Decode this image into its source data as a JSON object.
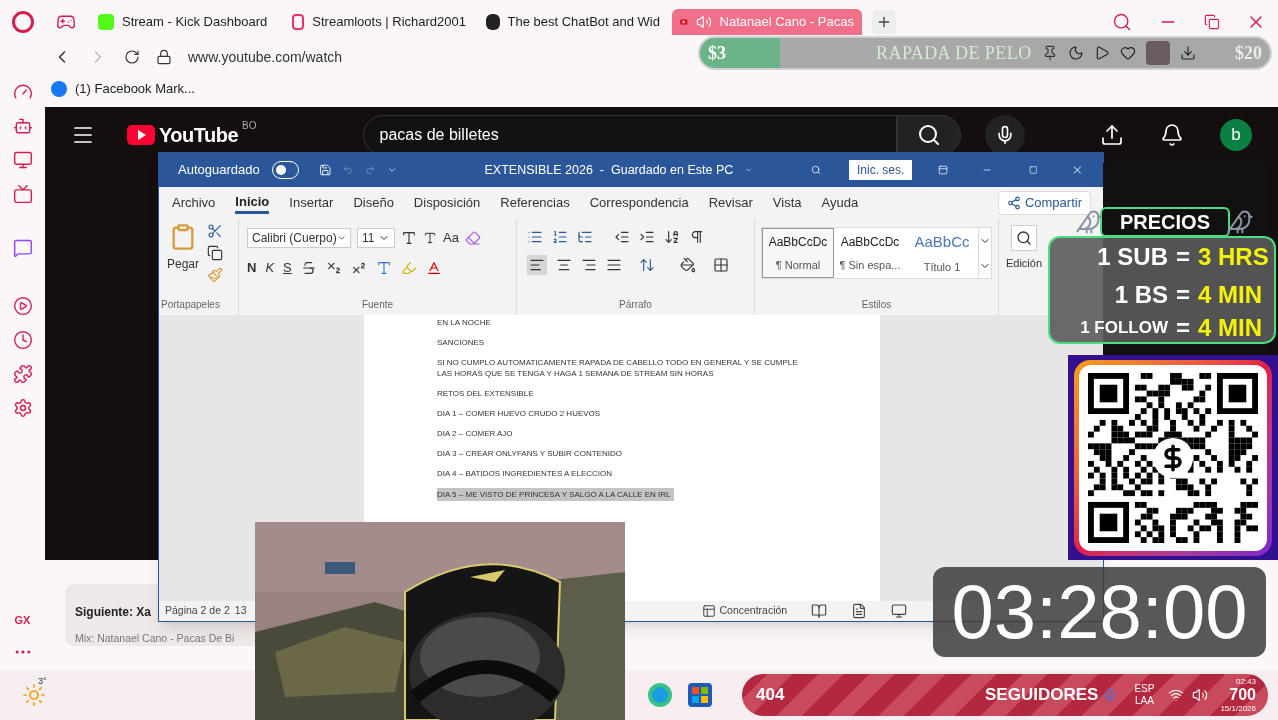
{
  "browser": {
    "tabs": [
      {
        "kind": "kick",
        "title": "Stream - Kick Dashboard",
        "selected": false
      },
      {
        "kind": "streamloots",
        "title": "Streamloots | Richard2001",
        "selected": false
      },
      {
        "kind": "chatbot",
        "title": "The best ChatBot and Wid",
        "selected": false
      },
      {
        "kind": "youtube",
        "title": "Natanael Cano - Pacas",
        "selected": true
      }
    ],
    "url": "www.youtube.com/watch",
    "bookmark": "(1) Facebook Mark...",
    "sidebar_label": "GX"
  },
  "youtube": {
    "logo": "YouTube",
    "country": "BO",
    "search": "pacas de billetes",
    "avatar": "b",
    "up_next": "Siguiente: Xa",
    "mix": "Mix: Natanael Cano - Pacas De Bi"
  },
  "word": {
    "autosave_label": "Autoguardado",
    "autosave_on": false,
    "title": "EXTENSIBLE 2026  -  Guardado en Este PC",
    "sign_in": "Inic. ses.",
    "tabs": [
      {
        "label": "Archivo",
        "selected": false
      },
      {
        "label": "Inicio",
        "selected": true
      },
      {
        "label": "Insertar",
        "selected": false
      },
      {
        "label": "Diseño",
        "selected": false
      },
      {
        "label": "Disposición",
        "selected": false
      },
      {
        "label": "Referencias",
        "selected": false
      },
      {
        "label": "Correspondencia",
        "selected": false
      },
      {
        "label": "Revisar",
        "selected": false
      },
      {
        "label": "Vista",
        "selected": false
      },
      {
        "label": "Ayuda",
        "selected": false
      }
    ],
    "share": "Compartir",
    "paste": "Pegar",
    "clipboard_group": "Portapapeles",
    "font_name": "Calibri (Cuerpo)",
    "font_size": "11",
    "case_button": "Aa",
    "bold": "N",
    "italic": "K",
    "underline": "S",
    "font_group": "Fuente",
    "paragraph_group": "Párrafo",
    "styles": [
      {
        "sample": "AaBbCcDc",
        "name": "¶ Normal",
        "selected": true,
        "kind": "body"
      },
      {
        "sample": "AaBbCcDc",
        "name": "¶ Sin espa...",
        "selected": false,
        "kind": "body"
      },
      {
        "sample": "AaBbCc",
        "name": "Título 1",
        "selected": false,
        "kind": "heading"
      }
    ],
    "styles_group": "Estilos",
    "editing": "Edición",
    "lines": [
      {
        "text": "EN LA NOCHE",
        "highlighted": false
      },
      {
        "text": "SANCIONES",
        "highlighted": false
      },
      {
        "text": "SI NO CUMPLO AUTOMATICAMENTE RAPADA DE CABELLO TODO EN GENERAL Y SE CUMPLE LAS HORAS QUE SE TENGA Y HAGA 1 SEMANA DE STREAM SIN HORAS",
        "highlighted": false
      },
      {
        "text": "RETOS DEL EXTENSIBLE",
        "highlighted": false
      },
      {
        "text": "DIA 1 – COMER HUEVO CRUDO 2 HUEVOS",
        "highlighted": false
      },
      {
        "text": "DIA 2 – COMER AJO",
        "highlighted": false
      },
      {
        "text": "DIA 3 – CREAR ONLYFANS Y SUBIR CONTENIDO",
        "highlighted": false
      },
      {
        "text": "DIA 4 – BATIDOS INGREDIENTES A ELECCION",
        "highlighted": false
      },
      {
        "text": "DIA 5 – ME VISTO DE PRINCESA Y SALGO A LA CALLE EN IRL",
        "highlighted": true
      }
    ],
    "page": "Página 2 de 2",
    "words": "13",
    "focus": "Concentración"
  },
  "overlay": {
    "tip_start": "$3",
    "goal": "RAPADA DE PELO",
    "tip_end": "$20",
    "level": 0.14,
    "prices_title": "PRECIOS",
    "prices": [
      {
        "item": "1 SUB",
        "equals": "=",
        "value": "3 HRS"
      },
      {
        "item": "1 BS",
        "equals": "=",
        "value": "4 MIN"
      },
      {
        "item": "1 FOLLOW",
        "equals": "=",
        "value": "4 MIN"
      }
    ],
    "timer": "03:28:00",
    "followers": "404",
    "followers_label": "SEGUIDORES",
    "followers_goal": "700"
  },
  "taskbar": {
    "weather": "3°",
    "language": "ESP",
    "layout": "LAA",
    "time": "02:43",
    "date": "15/1/2026"
  }
}
